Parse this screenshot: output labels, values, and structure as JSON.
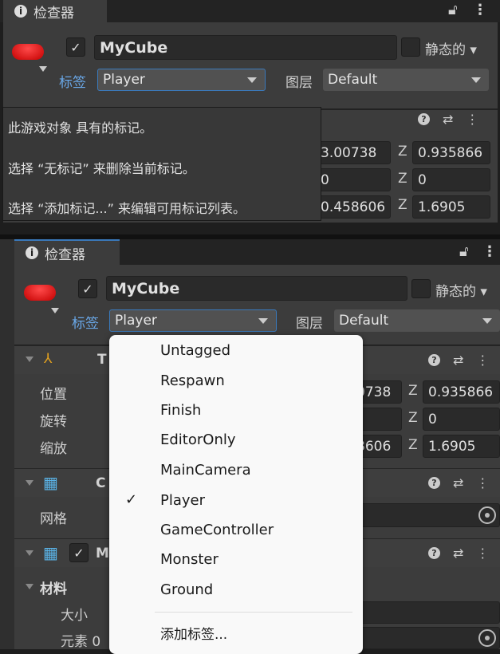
{
  "top": {
    "tab_title": "检查器",
    "object_name": "MyCube",
    "static_label": "静态的",
    "tag_label": "标签",
    "tag_value": "Player",
    "layer_label": "图层",
    "layer_value": "Default",
    "tooltip": [
      "此游戏对象 具有的标记。",
      "选择 “无标记” 来删除当前标记。",
      "选择 “添加标记...” 来编辑可用标记列表。"
    ],
    "rows": [
      {
        "x": "3.00738",
        "z_label": "Z",
        "z": "0.935866"
      },
      {
        "x": "0",
        "z_label": "Z",
        "z": "0"
      },
      {
        "x": "0.458606",
        "z_label": "Z",
        "z": "1.6905"
      }
    ]
  },
  "bottom": {
    "tab_title": "检查器",
    "object_name": "MyCube",
    "static_label": "静态的",
    "tag_label": "标签",
    "tag_value": "Player",
    "layer_label": "图层",
    "layer_value": "Default",
    "transform": {
      "title_initial": "T",
      "rows": [
        {
          "label": "位置",
          "x": "0738",
          "z_label": "Z",
          "z": "0.935866"
        },
        {
          "label": "旋转",
          "x": "",
          "z_label": "Z",
          "z": "0"
        },
        {
          "label": "缩放",
          "x": "8606",
          "z_label": "Z",
          "z": "1.6905"
        }
      ]
    },
    "mesh_filter": {
      "title_initial": "C",
      "row_label": "网格"
    },
    "mesh_renderer": {
      "title_initial": "M",
      "materials_label": "材料",
      "size_label": "大小",
      "element_label": "元素 0"
    },
    "dropdown": {
      "items": [
        "Untagged",
        "Respawn",
        "Finish",
        "EditorOnly",
        "MainCamera",
        "Player",
        "GameController",
        "Monster",
        "Ground"
      ],
      "selected": "Player",
      "add_label": "添加标签..."
    }
  },
  "colors": {
    "accent": "#3a79bb",
    "tag_label": "#6aa8e8",
    "panel": "#3c3c3c"
  }
}
